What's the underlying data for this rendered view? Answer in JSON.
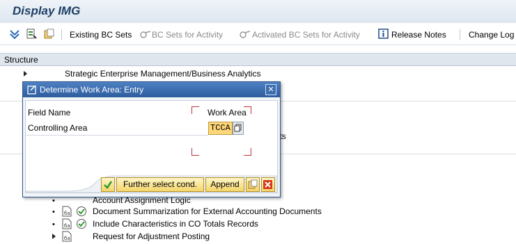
{
  "window": {
    "title": "Display IMG"
  },
  "toolbar": {
    "existing_bc_sets": "Existing BC Sets",
    "bc_sets_for_activity": "BC Sets for Activity",
    "activated_bc_sets": "Activated BC Sets for Activity",
    "release_notes": "Release Notes",
    "change_log": "Change Log"
  },
  "structure": {
    "header": "Structure",
    "rows": [
      "Strategic Enterprise Management/Business Analytics",
      "ments",
      "Account Assignment Logic",
      "Document Summarization for External Accounting Documents",
      "Include Characteristics in CO Totals Records",
      "Request for Adjustment Posting"
    ]
  },
  "dialog": {
    "title": "Determine Work Area: Entry",
    "field_name_header": "Field Name",
    "work_area_header": "Work Area",
    "field_label": "Controlling Area",
    "field_value": "TCCA",
    "buttons": {
      "further_select": "Further select cond.",
      "append": "Append"
    }
  },
  "colors": {
    "title_text": "#1e3f66",
    "dialog_title_bg": "#2d5d9e",
    "field_highlight": "#ffd77a",
    "button_bg": "#f5d56a",
    "check_green": "#2e9a2e",
    "cancel_red": "#d43b1a"
  }
}
